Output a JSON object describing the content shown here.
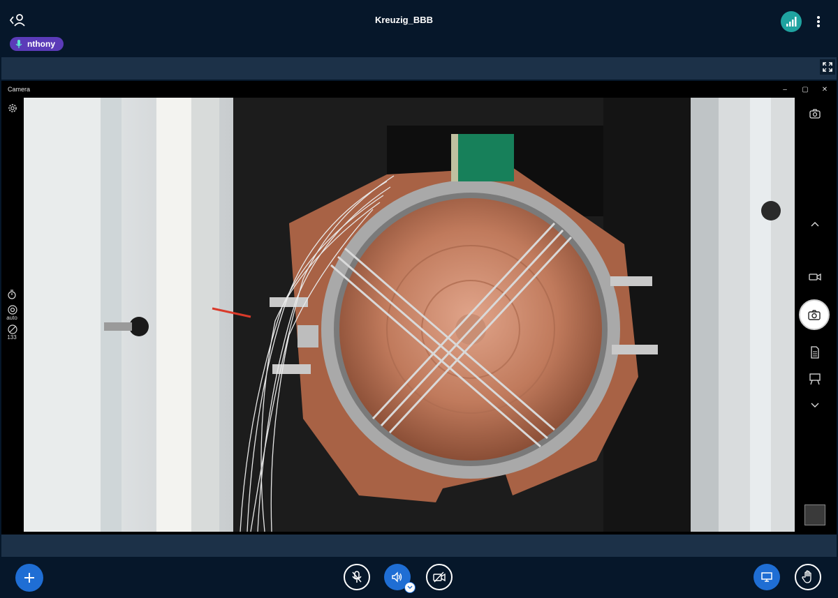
{
  "header": {
    "meeting_title": "Kreuzig_BBB",
    "talker_name": "nthony",
    "back_icon": "chevron-left-user-icon",
    "signal_icon": "connection-strength-icon",
    "menu_icon": "kebab-menu-icon"
  },
  "camera_app": {
    "window_title": "Camera",
    "minimize_glyph": "–",
    "restore_glyph": "▢",
    "close_glyph": "✕",
    "left_panel": {
      "settings_icon": "gear-icon",
      "timer_icon": "timer-icon",
      "focus_label": "auto",
      "exposure_value": "133"
    },
    "right_panel": {
      "switch_camera_icon": "switch-camera-icon",
      "modes": [
        "video",
        "photo",
        "document",
        "whiteboard"
      ],
      "selected_mode": "photo"
    }
  },
  "controls": {
    "plus_icon": "plus-icon",
    "mic_state": "muted",
    "speaker_state": "on",
    "video_state": "off",
    "screen_share_icon": "screen-share-icon",
    "raise_hand_icon": "raise-hand-icon"
  },
  "colors": {
    "background": "#06172a",
    "strip": "#1c3148",
    "accent_blue": "#1f6ed4",
    "talker_purple": "#5b3bb8",
    "signal_teal": "#1fa3a0"
  }
}
